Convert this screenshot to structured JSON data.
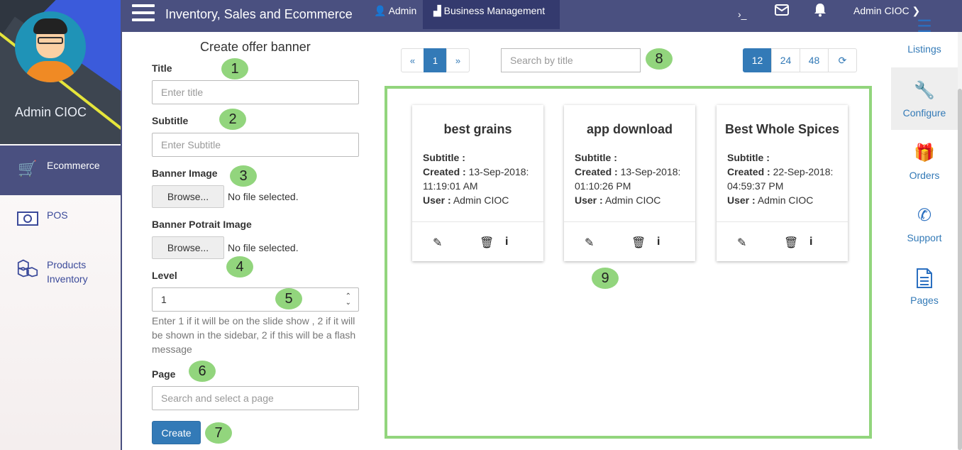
{
  "topbar": {
    "app_title": "Inventory, Sales and Ecommerce",
    "admin_label": "Admin",
    "business_label": "Business Management",
    "terminal_glyph": "›_",
    "user_label": "Admin CIOC"
  },
  "sidebar": {
    "profile_name": "Admin CIOC",
    "items": [
      {
        "label": "Ecommerce",
        "icon": "cart-icon",
        "active": true
      },
      {
        "label": "POS",
        "icon": "cash-icon",
        "active": false
      },
      {
        "label": "Products Inventory",
        "icon": "cubes-icon",
        "active": false
      }
    ]
  },
  "form": {
    "heading": "Create offer banner",
    "title_label": "Title",
    "title_placeholder": "Enter title",
    "subtitle_label": "Subtitle",
    "subtitle_placeholder": "Enter Subtitle",
    "banner_image_label": "Banner Image",
    "banner_portrait_label": "Banner Potrait Image",
    "browse_label": "Browse...",
    "no_file_text": "No file selected.",
    "level_label": "Level",
    "level_value": "1",
    "level_help": "Enter 1 if it will be on the slide show , 2 if it will be shown in the sidebar, 2 if this will be a flash message",
    "page_label": "Page",
    "page_placeholder": "Search and select a page",
    "create_label": "Create"
  },
  "markers": [
    "1",
    "2",
    "3",
    "4",
    "5",
    "6",
    "7",
    "8",
    "9"
  ],
  "pagination": {
    "prev": "«",
    "current": "1",
    "next": "»",
    "search_placeholder": "Search by title",
    "page_sizes": [
      "12",
      "24",
      "48"
    ],
    "active_size": "12"
  },
  "cards": [
    {
      "title": "best grains",
      "subtitle_label": "Subtitle :",
      "subtitle": "",
      "created_label": "Created :",
      "created": "13-Sep-2018: 11:19:01 AM",
      "user_label": "User :",
      "user": "Admin CIOC"
    },
    {
      "title": "app download",
      "subtitle_label": "Subtitle :",
      "subtitle": "",
      "created_label": "Created :",
      "created": "13-Sep-2018: 01:10:26 PM",
      "user_label": "User :",
      "user": "Admin CIOC"
    },
    {
      "title": "Best Whole Spices",
      "subtitle_label": "Subtitle :",
      "subtitle": "",
      "created_label": "Created :",
      "created": "22-Sep-2018: 04:59:37 PM",
      "user_label": "User :",
      "user": "Admin CIOC"
    }
  ],
  "right_sidebar": {
    "items": [
      {
        "label": "Listings",
        "icon": "list-icon"
      },
      {
        "label": "Configure",
        "icon": "wrench-icon",
        "active": true
      },
      {
        "label": "Orders",
        "icon": "gift-icon"
      },
      {
        "label": "Support",
        "icon": "phone-icon"
      },
      {
        "label": "Pages",
        "icon": "file-icon"
      }
    ]
  },
  "colors": {
    "topbar": "#4a5080",
    "topbar_active": "#343a6e",
    "primary": "#337ab7",
    "marker": "#92d57d"
  }
}
